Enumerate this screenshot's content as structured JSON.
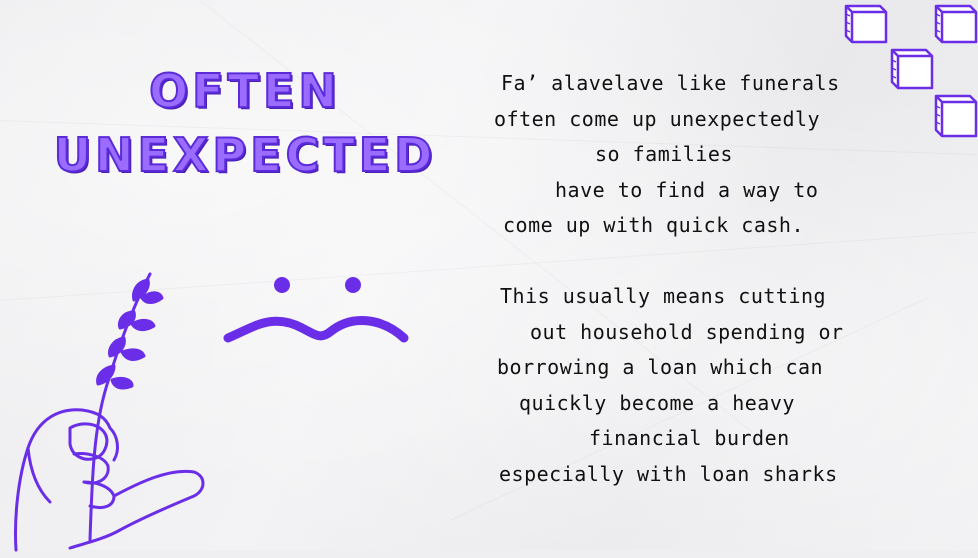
{
  "slide": {
    "title_lines": [
      "OFTEN",
      "UNEXPECTED"
    ],
    "paragraph1": [
      "Fa’ alavelave like funerals",
      "often come up unexpectedly",
      "so families",
      "have to find a way to",
      "come up with quick cash."
    ],
    "paragraph2": [
      "This usually means cutting",
      "out household spending or",
      "borrowing a loan which can",
      "quickly become a heavy",
      "financial burden",
      "especially with loan sharks"
    ]
  },
  "colors": {
    "accent": "#6b2ee8",
    "title_fill": "#9a6cff",
    "text": "#111111",
    "background": "#efeff1"
  },
  "icons": [
    "sad-face-icon",
    "hand-holding-branch-icon",
    "cube-icon"
  ]
}
